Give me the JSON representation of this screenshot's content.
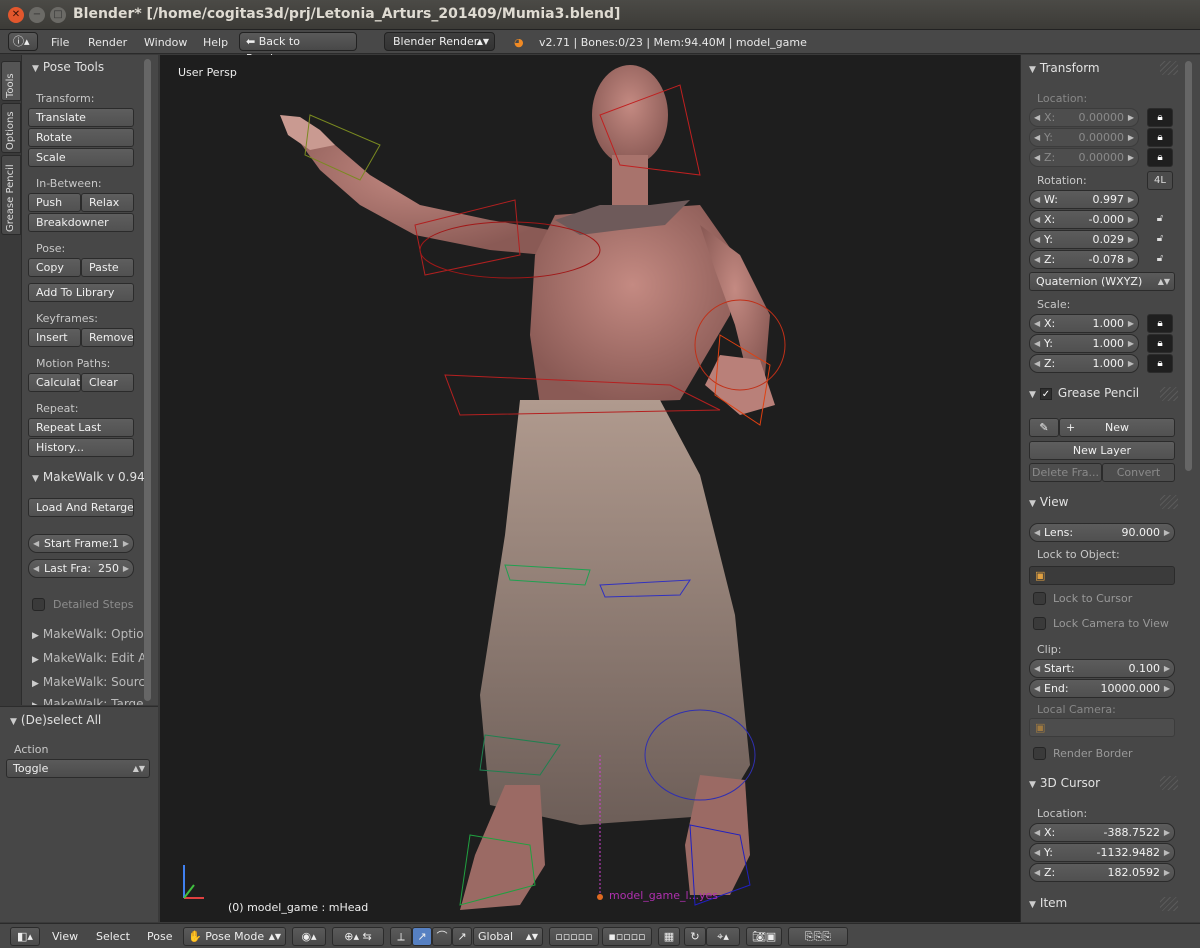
{
  "window": {
    "title": "Blender* [/home/cogitas3d/prj/Letonia_Arturs_201409/Mumia3.blend]"
  },
  "infobar": {
    "menus": [
      "File",
      "Render",
      "Window",
      "Help"
    ],
    "back_button": "Back to Previous",
    "render_engine": "Blender Render",
    "stats": "v2.71 | Bones:0/23  | Mem:94.40M | model_game"
  },
  "tool_tabs": [
    "Tools",
    "Options",
    "Grease Pencil"
  ],
  "tools": {
    "panel_title": "Pose Tools",
    "transform_label": "Transform:",
    "translate": "Translate",
    "rotate": "Rotate",
    "scale": "Scale",
    "inbetween_label": "In-Between:",
    "push": "Push",
    "relax": "Relax",
    "breakdowner": "Breakdowner",
    "pose_label": "Pose:",
    "copy": "Copy",
    "paste": "Paste",
    "add_to_library": "Add To Library",
    "keyframes_label": "Keyframes:",
    "insert": "Insert",
    "remove": "Remove",
    "motion_paths_label": "Motion Paths:",
    "calculate": "Calculat",
    "clear": "Clear",
    "repeat_label": "Repeat:",
    "repeat_last": "Repeat Last",
    "history": "History...",
    "makewalk_title": "MakeWalk v 0.94",
    "load_retarget": "Load And Retarget",
    "start_frame_label": "Start Frame:",
    "start_frame_value": "1",
    "last_frame_label": "Last Fra:",
    "last_frame_value": "250",
    "detailed_steps": "Detailed Steps",
    "makewalk_options": "MakeWalk: Optio",
    "makewalk_edit": "MakeWalk: Edit A",
    "makewalk_source": "MakeWalk: Sourc",
    "makewalk_target": "MakeWalk: Targe"
  },
  "operator": {
    "title": "(De)select All",
    "action_label": "Action",
    "action_value": "Toggle"
  },
  "viewport": {
    "view_name": "User Persp",
    "object_info": "(0) model_game : mHead",
    "bone_label": "model_game_l...yes"
  },
  "properties": {
    "transform_title": "Transform",
    "location_label": "Location:",
    "location": [
      {
        "axis": "X:",
        "value": "0.00000"
      },
      {
        "axis": "Y:",
        "value": "0.00000"
      },
      {
        "axis": "Z:",
        "value": "0.00000"
      }
    ],
    "rotation_label": "Rotation:",
    "rotation_4l": "4L",
    "rotation": [
      {
        "axis": "W:",
        "value": "0.997"
      },
      {
        "axis": "X:",
        "value": "-0.000"
      },
      {
        "axis": "Y:",
        "value": "0.029"
      },
      {
        "axis": "Z:",
        "value": "-0.078"
      }
    ],
    "rotation_mode": "Quaternion (WXYZ)",
    "scale_label": "Scale:",
    "scale": [
      {
        "axis": "X:",
        "value": "1.000"
      },
      {
        "axis": "Y:",
        "value": "1.000"
      },
      {
        "axis": "Z:",
        "value": "1.000"
      }
    ],
    "grease_pencil_title": "Grease Pencil",
    "gp_new": "New",
    "gp_new_layer": "New Layer",
    "gp_delete_frame": "Delete Fra...",
    "gp_convert": "Convert",
    "view_title": "View",
    "lens_label": "Lens:",
    "lens_value": "90.000",
    "lock_to_object_label": "Lock to Object:",
    "lock_to_cursor": "Lock to Cursor",
    "lock_camera_to_view": "Lock Camera to View",
    "clip_label": "Clip:",
    "clip_start_label": "Start:",
    "clip_start_value": "0.100",
    "clip_end_label": "End:",
    "clip_end_value": "10000.000",
    "local_camera_label": "Local Camera:",
    "render_border": "Render Border",
    "cursor_title": "3D Cursor",
    "cursor_location_label": "Location:",
    "cursor": [
      {
        "axis": "X:",
        "value": "-388.7522"
      },
      {
        "axis": "Y:",
        "value": "-1132.9482"
      },
      {
        "axis": "Z:",
        "value": "182.0592"
      }
    ],
    "item_title": "Item"
  },
  "bottombar": {
    "menus": [
      "View",
      "Select",
      "Pose"
    ],
    "mode": "Pose Mode",
    "orientation": "Global"
  }
}
